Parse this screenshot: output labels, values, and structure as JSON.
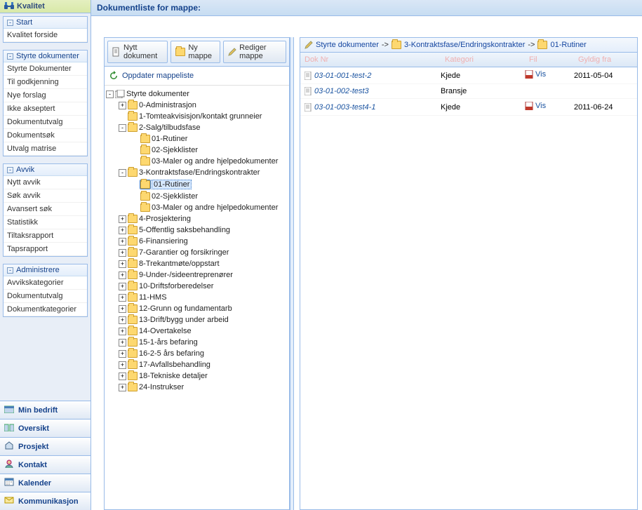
{
  "app_title": "Kvalitet",
  "main_title": "Dokumentliste for mappe:",
  "side_panels": [
    {
      "title": "Start",
      "items": [
        "Kvalitet forside"
      ]
    },
    {
      "title": "Styrte dokumenter",
      "items": [
        "Styrte Dokumenter",
        "Til godkjenning",
        "Nye forslag",
        "Ikke akseptert",
        "Dokumentutvalg",
        "Dokumentsøk",
        "Utvalg matrise"
      ]
    },
    {
      "title": "Avvik",
      "items": [
        "Nytt avvik",
        "Søk avvik",
        "Avansert søk",
        "Statistikk",
        "Tiltaksrapport",
        "Tapsrapport"
      ]
    },
    {
      "title": "Administrere",
      "items": [
        "Avvikskategorier",
        "Dokumentutvalg",
        "Dokumentkategorier"
      ]
    }
  ],
  "bottom_nav": [
    "Min bedrift",
    "Oversikt",
    "Prosjekt",
    "Kontakt",
    "Kalender",
    "Kommunikasjon"
  ],
  "toolbar": {
    "new_doc": "Nytt dokument",
    "new_folder": "Ny mappe",
    "edit_folder": "Rediger mappe"
  },
  "update_label": "Oppdater mappeliste",
  "tree_root": "Styrte dokumenter",
  "tree": [
    {
      "label": "0-Administrasjon",
      "exp": "+",
      "indent": 1
    },
    {
      "label": "1-Tomteakvisisjon/kontakt grunneier",
      "exp": "",
      "indent": 1
    },
    {
      "label": "2-Salg/tilbudsfase",
      "exp": "-",
      "indent": 1
    },
    {
      "label": "01-Rutiner",
      "exp": "",
      "indent": 2
    },
    {
      "label": "02-Sjekklister",
      "exp": "",
      "indent": 2
    },
    {
      "label": "03-Maler og andre hjelpedokumenter",
      "exp": "",
      "indent": 2
    },
    {
      "label": "3-Kontraktsfase/Endringskontrakter",
      "exp": "-",
      "indent": 1
    },
    {
      "label": "01-Rutiner",
      "exp": "",
      "indent": 2,
      "selected": true
    },
    {
      "label": "02-Sjekklister",
      "exp": "",
      "indent": 2
    },
    {
      "label": "03-Maler og andre hjelpedokumenter",
      "exp": "",
      "indent": 2
    },
    {
      "label": "4-Prosjektering",
      "exp": "+",
      "indent": 1
    },
    {
      "label": "5-Offentlig saksbehandling",
      "exp": "+",
      "indent": 1
    },
    {
      "label": "6-Finansiering",
      "exp": "+",
      "indent": 1
    },
    {
      "label": "7-Garantier og forsikringer",
      "exp": "+",
      "indent": 1
    },
    {
      "label": "8-Trekantmøte/oppstart",
      "exp": "+",
      "indent": 1
    },
    {
      "label": "9-Under-/sideentreprenører",
      "exp": "+",
      "indent": 1
    },
    {
      "label": "10-Driftsforberedelser",
      "exp": "+",
      "indent": 1
    },
    {
      "label": "11-HMS",
      "exp": "+",
      "indent": 1
    },
    {
      "label": "12-Grunn og fundamentarb",
      "exp": "+",
      "indent": 1
    },
    {
      "label": "13-Drift/bygg under arbeid",
      "exp": "+",
      "indent": 1
    },
    {
      "label": "14-Overtakelse",
      "exp": "+",
      "indent": 1
    },
    {
      "label": "15-1-års befaring",
      "exp": "+",
      "indent": 1
    },
    {
      "label": "16-2-5 års befaring",
      "exp": "+",
      "indent": 1
    },
    {
      "label": "17-Avfallsbehandling",
      "exp": "+",
      "indent": 1
    },
    {
      "label": "18-Tekniske detaljer",
      "exp": "+",
      "indent": 1
    },
    {
      "label": "24-Instrukser",
      "exp": "+",
      "indent": 1
    }
  ],
  "breadcrumb": {
    "root": "Styrte dokumenter",
    "mid": "3-Kontraktsfase/Endringskontrakter",
    "leaf": "01-Rutiner",
    "arrow": "->"
  },
  "columns": [
    "Dok Nr",
    "Kategori",
    "Fil",
    "Gyldig fra"
  ],
  "rows": [
    {
      "doc": "03-01-001-test-2",
      "cat": "Kjede",
      "file": "Vis",
      "date": "2011-05-04"
    },
    {
      "doc": "03-01-002-test3",
      "cat": "Bransje",
      "file": "",
      "date": ""
    },
    {
      "doc": "03-01-003-test4-1",
      "cat": "Kjede",
      "file": "Vis",
      "date": "2011-06-24"
    }
  ]
}
